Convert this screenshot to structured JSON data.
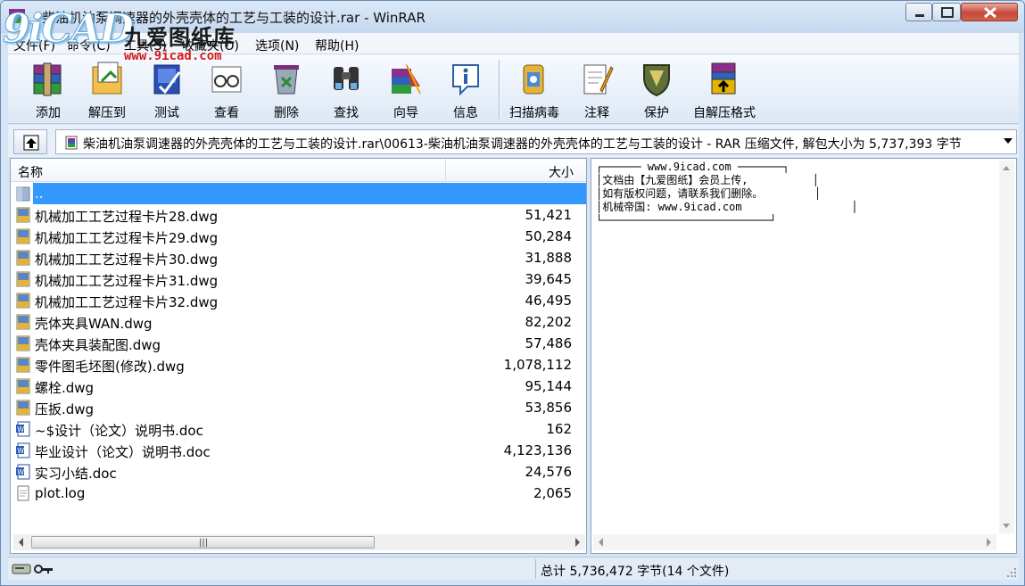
{
  "window": {
    "title": "柴油机油泵调速器的外壳壳体的工艺与工装的设计.rar - WinRAR"
  },
  "watermark": {
    "logo_text": "9iCAD",
    "chinese": "九爱图纸库",
    "url": "www.9icad.com"
  },
  "menu": {
    "items": [
      "文件(F)",
      "命令(C)",
      "工具(S)",
      "收藏夹(O)",
      "选项(N)",
      "帮助(H)"
    ]
  },
  "toolbar": {
    "buttons": [
      {
        "label": "添加",
        "icon": "add-archive-icon"
      },
      {
        "label": "解压到",
        "icon": "extract-to-icon"
      },
      {
        "label": "测试",
        "icon": "test-icon"
      },
      {
        "label": "查看",
        "icon": "view-icon"
      },
      {
        "label": "删除",
        "icon": "delete-icon"
      },
      {
        "label": "查找",
        "icon": "find-icon"
      },
      {
        "label": "向导",
        "icon": "wizard-icon"
      },
      {
        "label": "信息",
        "icon": "info-icon"
      },
      {
        "label": "扫描病毒",
        "icon": "virus-scan-icon"
      },
      {
        "label": "注释",
        "icon": "comment-icon"
      },
      {
        "label": "保护",
        "icon": "protect-icon"
      },
      {
        "label": "自解压格式",
        "icon": "sfx-icon"
      }
    ]
  },
  "address": {
    "path": "柴油机油泵调速器的外壳壳体的工艺与工装的设计.rar\\00613-柴油机油泵调速器的外壳壳体的工艺与工装的设计 - RAR 压缩文件, 解包大小为 5,737,393 字节"
  },
  "file_list": {
    "columns": {
      "name": "名称",
      "size": "大小"
    },
    "rows": [
      {
        "name": "..",
        "size": "",
        "type": "folder"
      },
      {
        "name": "机械加工工艺过程卡片28.dwg",
        "size": "51,421",
        "type": "dwg"
      },
      {
        "name": "机械加工工艺过程卡片29.dwg",
        "size": "50,284",
        "type": "dwg"
      },
      {
        "name": "机械加工工艺过程卡片30.dwg",
        "size": "31,888",
        "type": "dwg"
      },
      {
        "name": "机械加工工艺过程卡片31.dwg",
        "size": "39,645",
        "type": "dwg"
      },
      {
        "name": "机械加工工艺过程卡片32.dwg",
        "size": "46,495",
        "type": "dwg"
      },
      {
        "name": "壳体夹具WAN.dwg",
        "size": "82,202",
        "type": "dwg"
      },
      {
        "name": "壳体夹具装配图.dwg",
        "size": "57,486",
        "type": "dwg"
      },
      {
        "name": "零件图毛坯图(修改).dwg",
        "size": "1,078,112",
        "type": "dwg"
      },
      {
        "name": "螺栓.dwg",
        "size": "95,144",
        "type": "dwg"
      },
      {
        "name": "压扳.dwg",
        "size": "53,856",
        "type": "dwg"
      },
      {
        "name": "~$设计（论文）说明书.doc",
        "size": "162",
        "type": "doc"
      },
      {
        "name": "毕业设计（论文）说明书.doc",
        "size": "4,123,136",
        "type": "doc"
      },
      {
        "name": "实习小结.doc",
        "size": "24,576",
        "type": "doc"
      },
      {
        "name": "plot.log",
        "size": "2,065",
        "type": "log"
      }
    ]
  },
  "comment": {
    "text": "┌────── www.9icad.com ───────┐\n│文档由【九爱图纸】会员上传,          │\n│如有版权问题，请联系我们删除。        │\n│机械帝国: www.9icad.com                 │\n└──────────────────────────┘"
  },
  "status": {
    "summary": "总计 5,736,472 字节(14 个文件)"
  },
  "colors": {
    "selection": "#3399ff",
    "frame": "#d6e5f5",
    "close_button": "#c6493a"
  }
}
